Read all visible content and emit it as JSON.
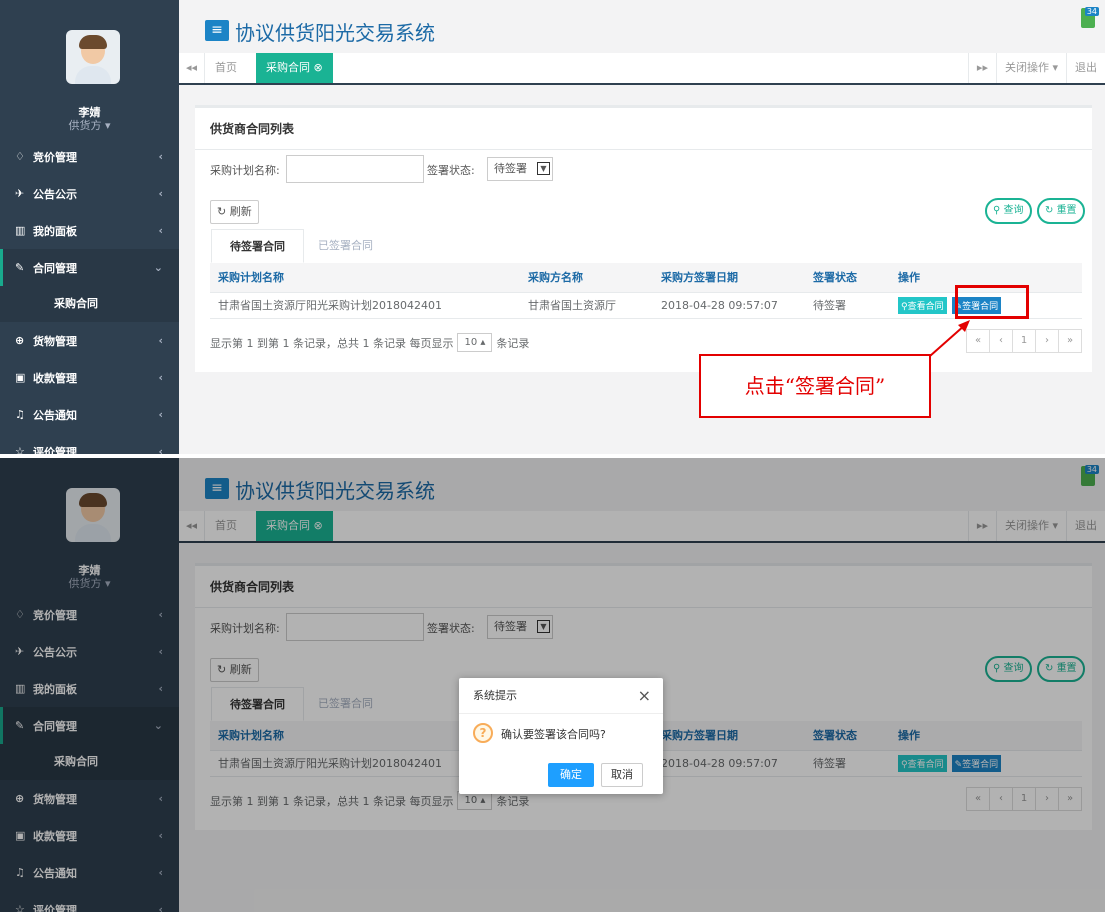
{
  "app": {
    "title": "协议供货阳光交易系统",
    "notify_count": "34"
  },
  "user": {
    "name": "李婧",
    "role": "供货方 ▾"
  },
  "sidebar": {
    "items": [
      {
        "icon": "diamond-icon",
        "glyph": "♢",
        "label": "竞价管理"
      },
      {
        "icon": "paper-plane-icon",
        "glyph": "✈",
        "label": "公告公示"
      },
      {
        "icon": "columns-icon",
        "glyph": "▥",
        "label": "我的面板"
      },
      {
        "icon": "edit-icon",
        "glyph": "✎",
        "label": "合同管理",
        "sub": "采购合同"
      },
      {
        "icon": "compass-icon",
        "glyph": "⊕",
        "label": "货物管理"
      },
      {
        "icon": "image-icon",
        "glyph": "▣",
        "label": "收款管理"
      },
      {
        "icon": "bell-icon",
        "glyph": "♫",
        "label": "公告通知"
      },
      {
        "icon": "star-icon",
        "glyph": "☆",
        "label": "评价管理"
      }
    ]
  },
  "tabs": {
    "home": "首页",
    "active": "采购合同 ⊗",
    "close_ops": "关闭操作 ▾",
    "logout": "退出"
  },
  "panel": {
    "title": "供货商合同列表",
    "plan_label": "采购计划名称:",
    "status_label": "签署状态:",
    "status_value": "待签署",
    "refresh": "刷新",
    "search": "查询",
    "reset": "重置",
    "tab_pending": "待签署合同",
    "tab_signed": "已签署合同"
  },
  "table": {
    "headers": [
      "采购计划名称",
      "采购方名称",
      "采购方签署日期",
      "签署状态",
      "操作"
    ],
    "rows": [
      {
        "plan": "甘肃省国土资源厅阳光采购计划2018042401",
        "buyer": "甘肃省国土资源厅",
        "date": "2018-04-28 09:57:07",
        "status": "待签署",
        "view": "查看合同",
        "sign": "签署合同"
      }
    ]
  },
  "footer": {
    "text1": "显示第 1 到第 1 条记录，总共 1 条记录 每页显示",
    "page_size": "10 ▴",
    "text2": "条记录"
  },
  "pager": [
    "«",
    "‹",
    "1",
    "›",
    "»"
  ],
  "callout": "点击“签署合同”",
  "dialog": {
    "title": "系统提示",
    "message": "确认要签署该合同吗?",
    "ok": "确定",
    "cancel": "取消"
  },
  "colors": {
    "sidebar": "#2f4050",
    "accent": "#1ab394",
    "primary": "#1c84c6",
    "highlight": "#e30000"
  }
}
